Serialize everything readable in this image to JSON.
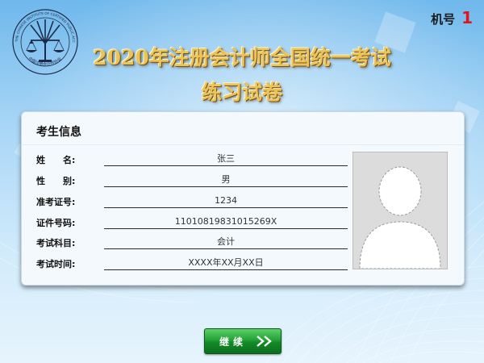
{
  "header": {
    "logo_text_top": "THE CHINESE INSTITUTE OF CERTIFIED PUBLIC ACCOUNTANTS",
    "logo_text_bottom": "中国注册会计师协会",
    "title_line1": "2020年注册会计师全国统一考试",
    "title_line2": "练习试卷",
    "machine_label": "机号",
    "machine_number": "1"
  },
  "card": {
    "title": "考生信息",
    "fields": [
      {
        "label": "姓　　名:",
        "value": "张三"
      },
      {
        "label": "性　　别:",
        "value": "男"
      },
      {
        "label": "准考证号:",
        "value": "1234"
      },
      {
        "label": "证件号码:",
        "value": "11010819831015269X"
      },
      {
        "label": "考试科目:",
        "value": "会计"
      },
      {
        "label": "考试时间:",
        "value": "XXXX年XX月XX日"
      }
    ]
  },
  "actions": {
    "continue_label": "继续"
  },
  "icons": {
    "logo": "cicpa-scales-logo-icon",
    "photo": "avatar-silhouette-icon",
    "continue_arrow": "double-chevron-right-icon"
  },
  "colors": {
    "title_gold": "#e9c45a",
    "machine_number_red": "#e0141a",
    "button_green": "#22a236"
  }
}
